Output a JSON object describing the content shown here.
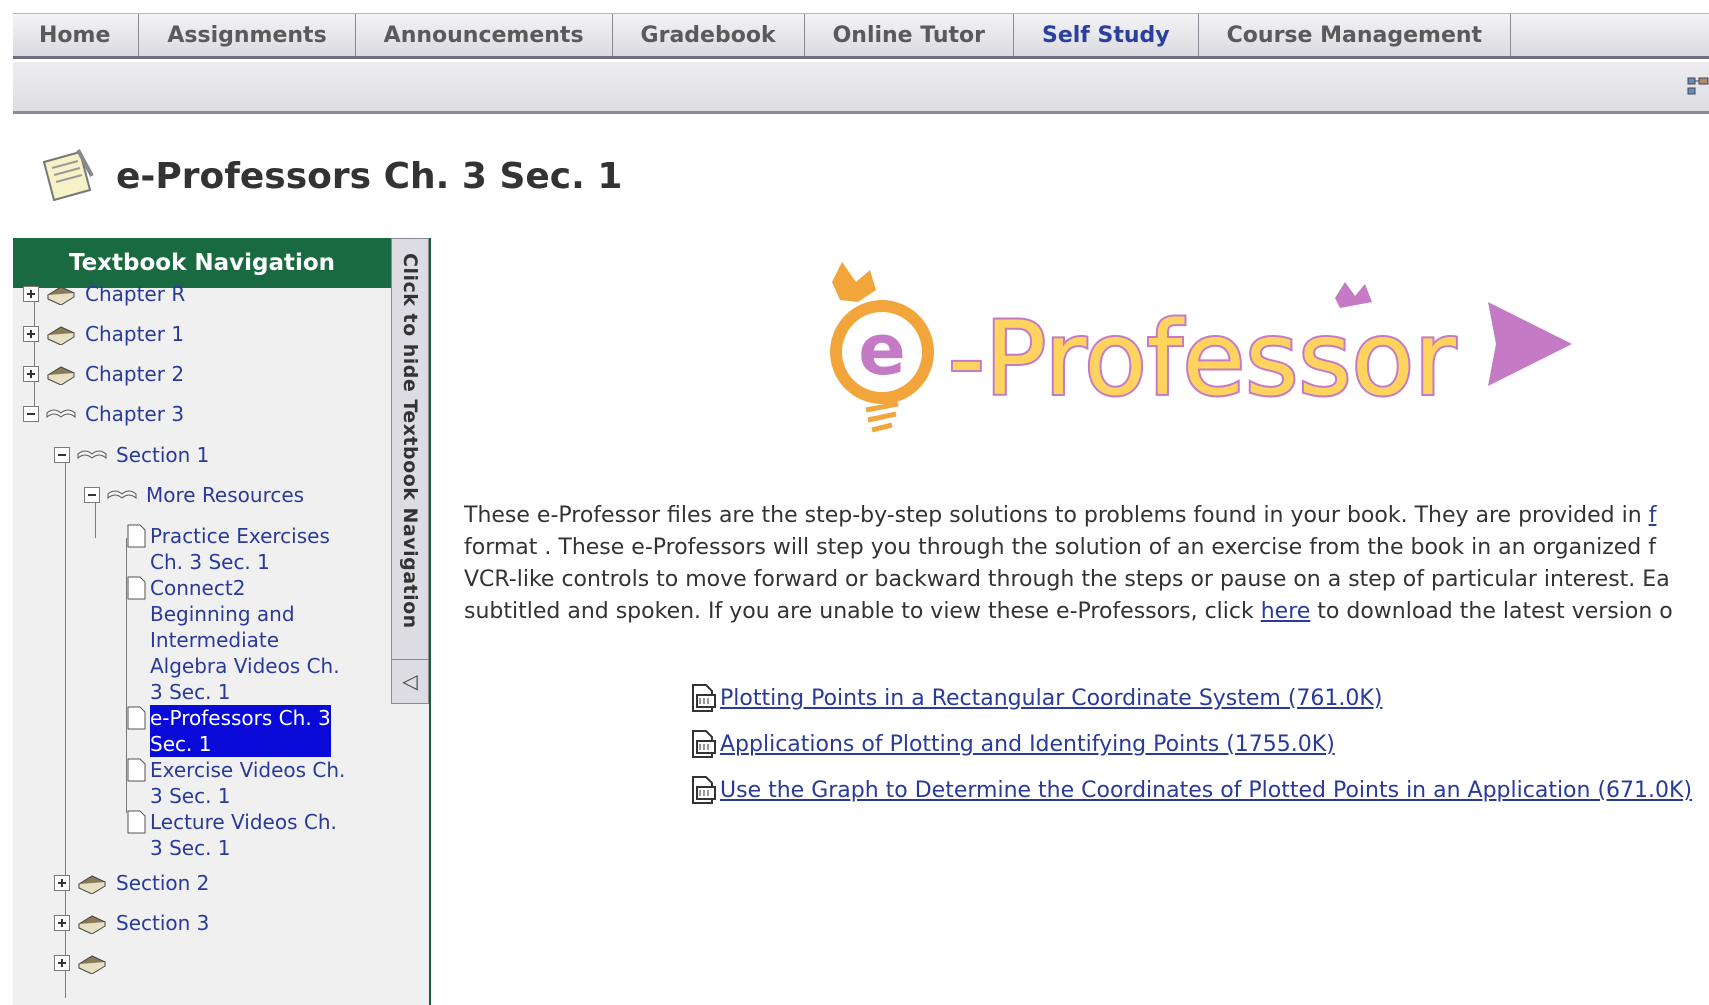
{
  "tabs": [
    {
      "label": "Home",
      "active": false
    },
    {
      "label": "Assignments",
      "active": false
    },
    {
      "label": "Announcements",
      "active": false
    },
    {
      "label": "Gradebook",
      "active": false
    },
    {
      "label": "Online Tutor",
      "active": false
    },
    {
      "label": "Self Study",
      "active": true
    },
    {
      "label": "Course Management",
      "active": false
    }
  ],
  "page": {
    "title": "e-Professors Ch. 3 Sec. 1"
  },
  "nav": {
    "header": "Textbook Navigation",
    "hide_label": "Click to hide Textbook Navigation",
    "items": [
      {
        "label": "Chapter R"
      },
      {
        "label": "Chapter 1"
      },
      {
        "label": "Chapter 2"
      },
      {
        "label": "Chapter 3"
      },
      {
        "label": "Section 1"
      },
      {
        "label": "More Resources"
      },
      {
        "label": "Practice Exercises\nCh. 3 Sec. 1"
      },
      {
        "label": "Connect2\nBeginning and\nIntermediate\nAlgebra Videos Ch.\n3 Sec. 1"
      },
      {
        "label": "e-Professors Ch. 3\nSec. 1"
      },
      {
        "label": "Exercise Videos Ch.\n3 Sec. 1"
      },
      {
        "label": "Lecture Videos Ch.\n3 Sec. 1"
      },
      {
        "label": "Section 2"
      },
      {
        "label": "Section 3"
      }
    ]
  },
  "logo": {
    "text": "e-Professor"
  },
  "intro": {
    "line1_pre": "These e-Professor files are the step-by-step solutions to problems found in your book. They are provided in ",
    "line1_link": "f",
    "line2": "format . These e-Professors will step you through the solution of an exercise from the book in an organized f",
    "line3": "VCR-like controls to move forward or backward through the steps or pause on a step of particular interest. Ea",
    "line4_pre": "subtitled and spoken. If you are unable to view these e-Professors, click ",
    "line4_link": "here",
    "line4_post": " to download the latest version o"
  },
  "files": [
    {
      "label": "Plotting Points in a Rectangular Coordinate System (761.0K)"
    },
    {
      "label": "Applications of Plotting and Identifying Points (1755.0K)"
    },
    {
      "label": "Use the Graph to Determine the Coordinates of Plotted Points in an Application (671.0K)"
    }
  ],
  "colors": {
    "nav_header": "#1a6a41",
    "link": "#2a3a9a",
    "active_tab": "#2b3f9c",
    "selection": "#0a0ad8"
  }
}
